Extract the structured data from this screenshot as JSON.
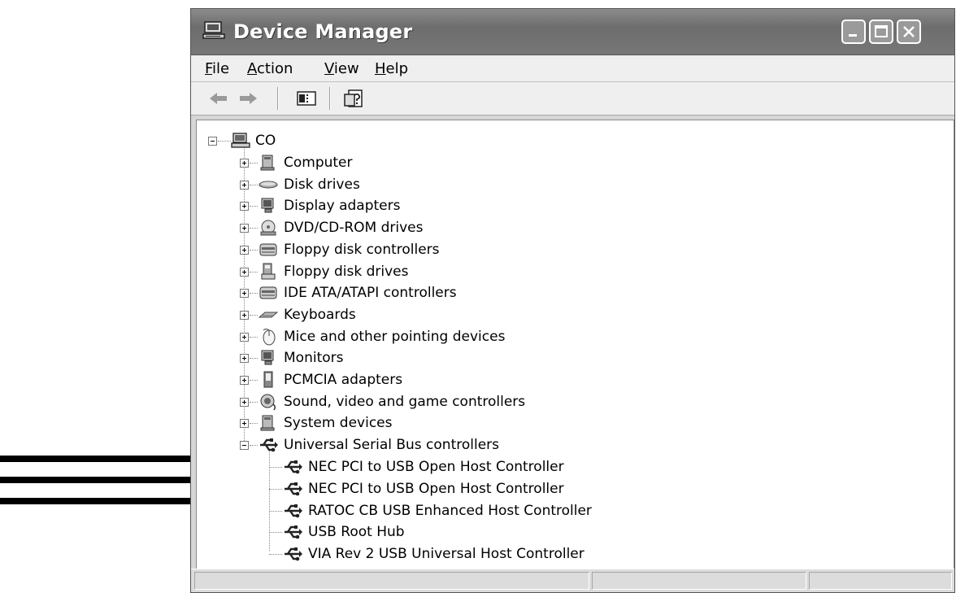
{
  "window": {
    "title": "Device Manager"
  },
  "menu": {
    "items": [
      "File",
      "Action",
      "View",
      "Help"
    ]
  },
  "toolbar": {
    "buttons": [
      "back-icon",
      "forward-icon",
      "show-hide-tree-icon",
      "properties-icon"
    ]
  },
  "tree": {
    "root": {
      "label": "CO",
      "icon": "computer-icon",
      "expanded": true
    },
    "categories": [
      {
        "label": "Computer",
        "icon": "computer-icon"
      },
      {
        "label": "Disk drives",
        "icon": "disk-drive-icon"
      },
      {
        "label": "Display adapters",
        "icon": "display-adapter-icon"
      },
      {
        "label": "DVD/CD-ROM drives",
        "icon": "dvd-drive-icon"
      },
      {
        "label": "Floppy disk controllers",
        "icon": "floppy-controller-icon"
      },
      {
        "label": "Floppy disk drives",
        "icon": "floppy-drive-icon"
      },
      {
        "label": "IDE ATA/ATAPI controllers",
        "icon": "ide-controller-icon"
      },
      {
        "label": "Keyboards",
        "icon": "keyboard-icon"
      },
      {
        "label": "Mice and other pointing devices",
        "icon": "mouse-icon"
      },
      {
        "label": "Monitors",
        "icon": "monitor-icon"
      },
      {
        "label": "PCMCIA adapters",
        "icon": "pcmcia-icon"
      },
      {
        "label": "Sound, video and game controllers",
        "icon": "sound-icon"
      },
      {
        "label": "System devices",
        "icon": "system-device-icon"
      },
      {
        "label": "Universal Serial Bus controllers",
        "icon": "usb-icon",
        "expanded": true
      }
    ],
    "usb_devices": [
      {
        "label": "NEC PCI to USB Open Host Controller",
        "icon": "usb-icon"
      },
      {
        "label": "NEC PCI to USB Open Host Controller",
        "icon": "usb-icon"
      },
      {
        "label": "RATOC CB USB Enhanced Host Controller",
        "icon": "usb-icon"
      },
      {
        "label": "USB Root Hub",
        "icon": "usb-icon"
      },
      {
        "label": "VIA Rev 2 USB Universal Host Controller",
        "icon": "usb-icon"
      }
    ]
  },
  "annotations": {
    "arrows_pointing_to": [
      0,
      1,
      2
    ]
  },
  "colors": {
    "titlebar": "#7a7a7a",
    "background": "#d6d6d6",
    "tree_bg": "#ffffff"
  }
}
